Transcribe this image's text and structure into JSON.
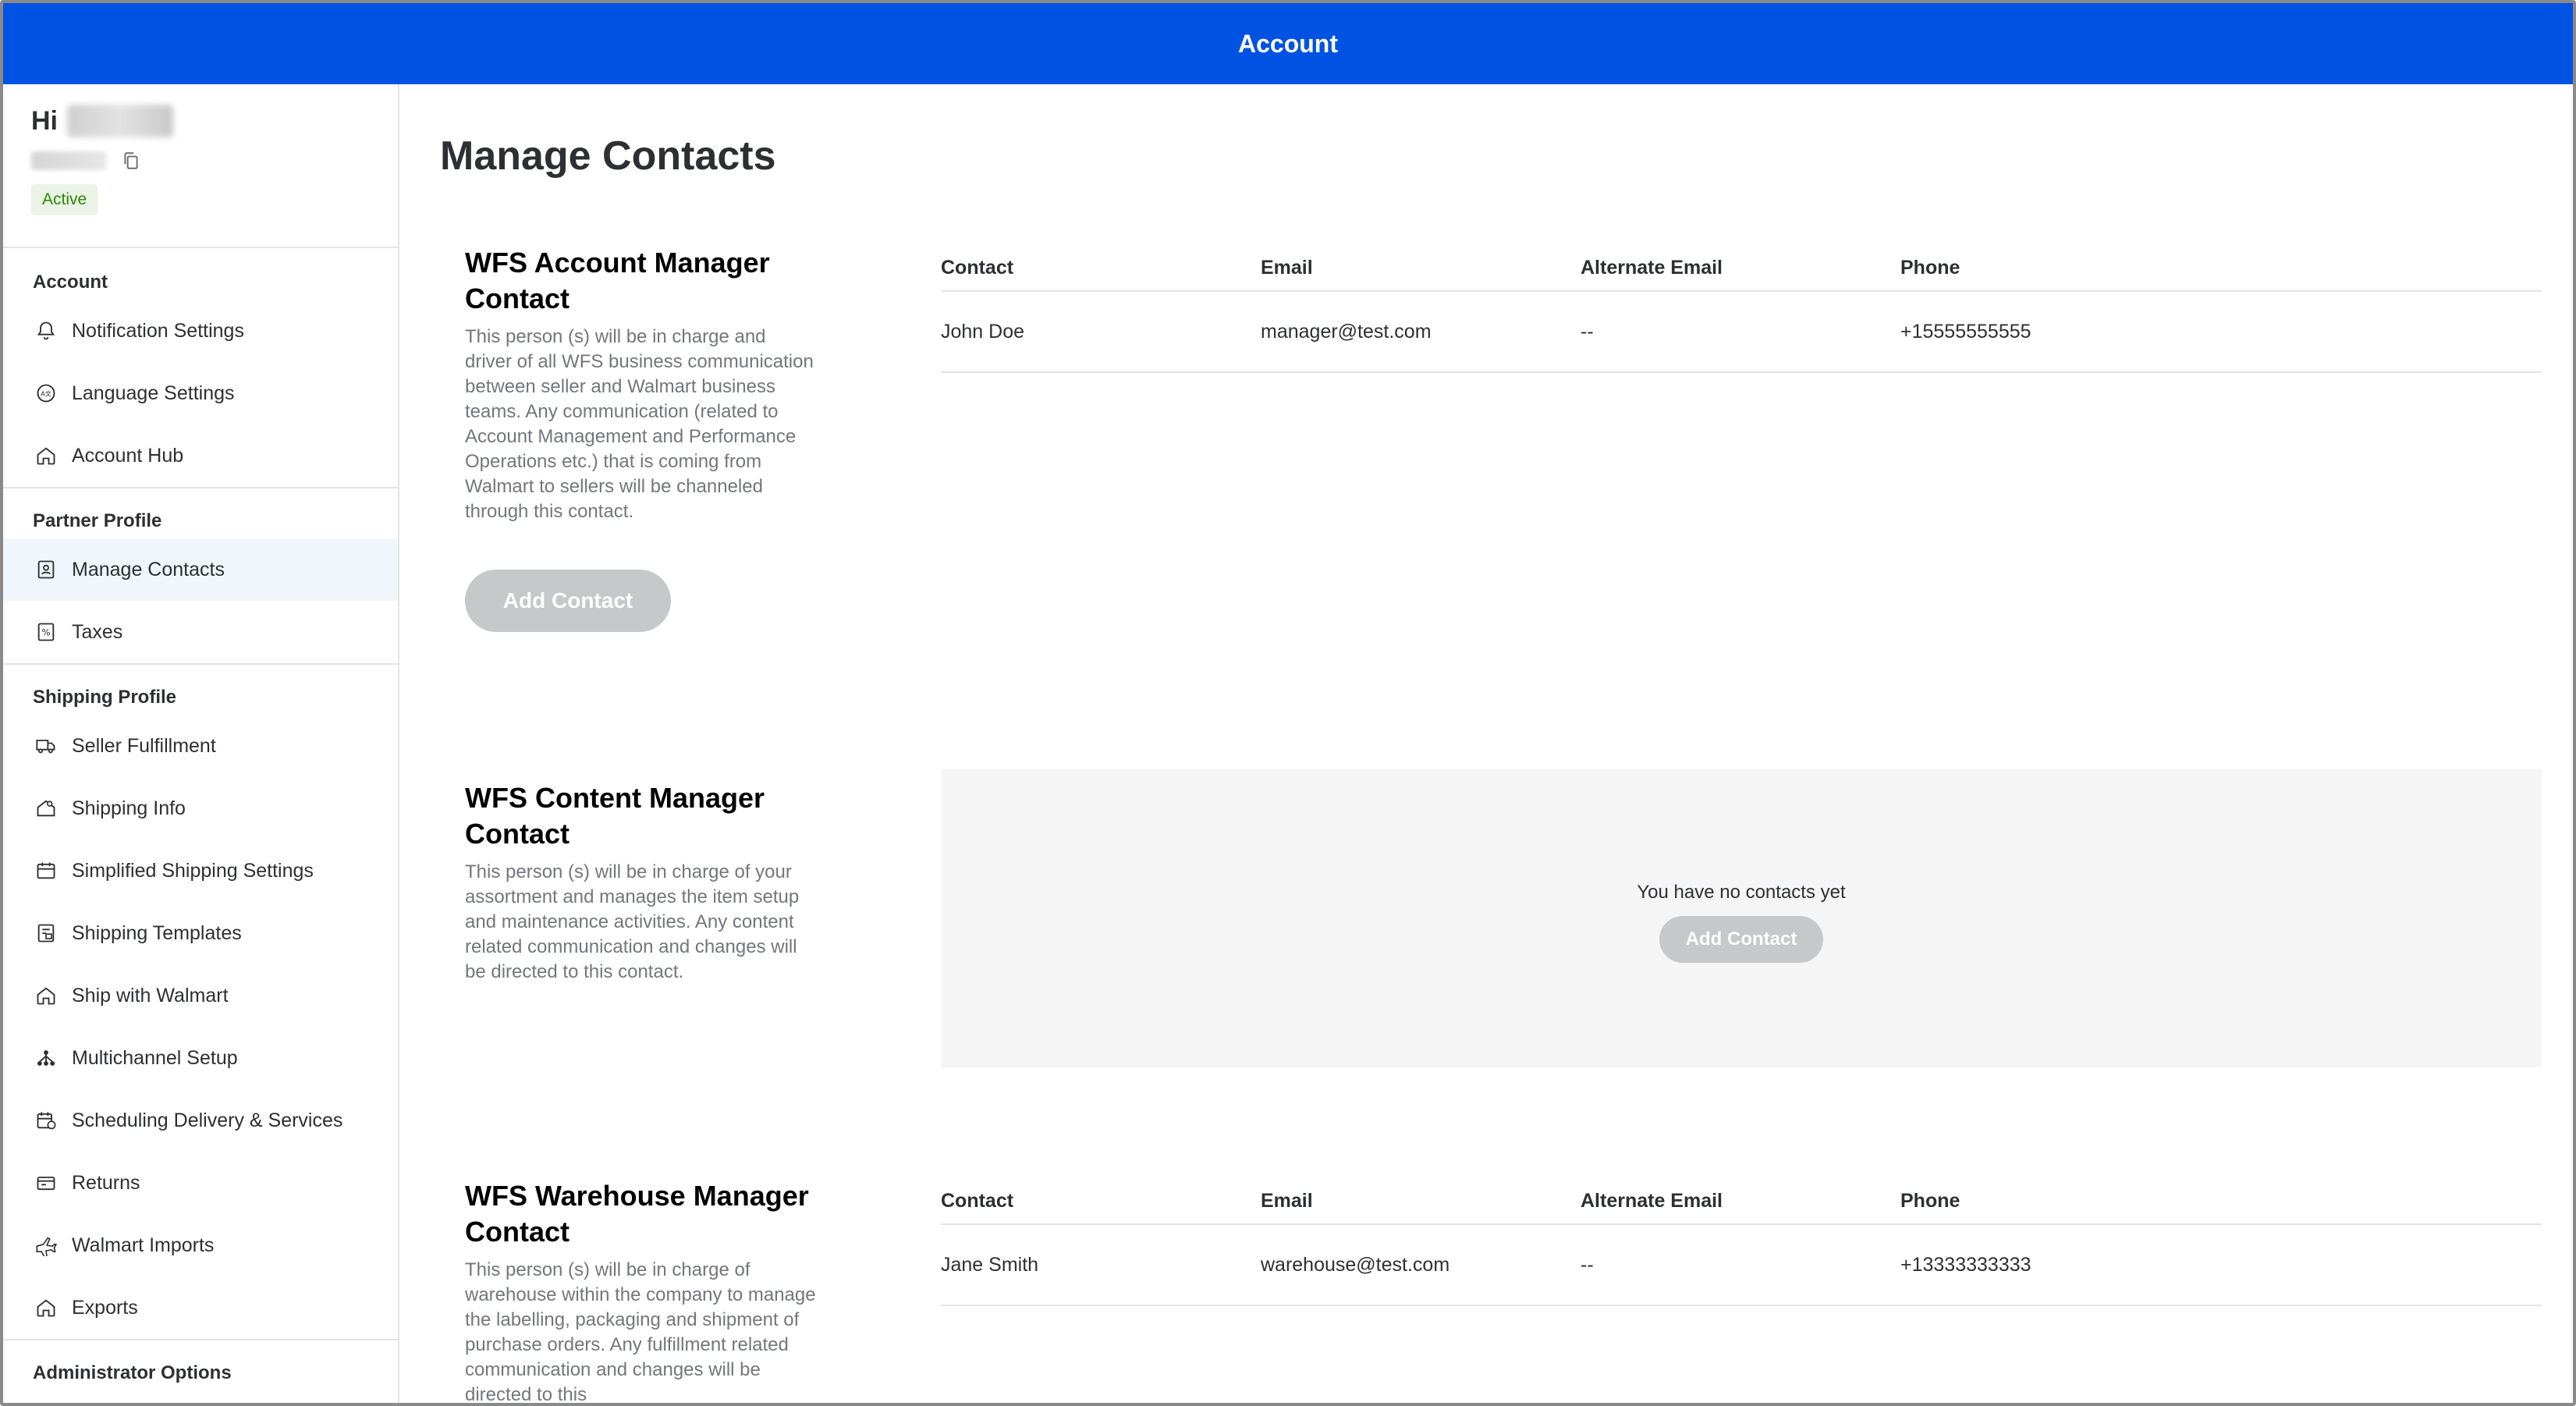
{
  "header": {
    "title": "Account"
  },
  "user": {
    "greeting": "Hi",
    "status_badge": "Active"
  },
  "sidebar": {
    "groups": [
      {
        "title": "Account",
        "items": [
          {
            "label": "Notification Settings",
            "icon": "bell-icon"
          },
          {
            "label": "Language Settings",
            "icon": "language-icon"
          },
          {
            "label": "Account Hub",
            "icon": "home-icon"
          }
        ]
      },
      {
        "title": "Partner Profile",
        "items": [
          {
            "label": "Manage Contacts",
            "icon": "contacts-icon",
            "active": true
          },
          {
            "label": "Taxes",
            "icon": "tax-icon"
          }
        ]
      },
      {
        "title": "Shipping Profile",
        "items": [
          {
            "label": "Seller Fulfillment",
            "icon": "truck-icon"
          },
          {
            "label": "Shipping Info",
            "icon": "house-settings-icon"
          },
          {
            "label": "Simplified Shipping Settings",
            "icon": "calendar-icon"
          },
          {
            "label": "Shipping Templates",
            "icon": "template-icon"
          },
          {
            "label": "Ship with Walmart",
            "icon": "home-icon"
          },
          {
            "label": "Multichannel Setup",
            "icon": "network-icon"
          },
          {
            "label": "Scheduling Delivery & Services",
            "icon": "schedule-icon"
          },
          {
            "label": "Returns",
            "icon": "returns-icon"
          },
          {
            "label": "Walmart Imports",
            "icon": "plane-icon"
          },
          {
            "label": "Exports",
            "icon": "home-icon"
          }
        ]
      },
      {
        "title": "Administrator Options",
        "items": []
      }
    ]
  },
  "main": {
    "title": "Manage Contacts",
    "sections": [
      {
        "title": "WFS Account Manager Contact",
        "description": "This person (s) will be in charge and driver of all WFS business communication between seller and Walmart business teams. Any communication (related to Account Management and Performance Operations etc.) that is coming from Walmart to sellers will be channeled through this contact.",
        "add_button": "Add Contact",
        "columns": [
          "Contact",
          "Email",
          "Alternate Email",
          "Phone"
        ],
        "rows": [
          {
            "contact": "John Doe",
            "email": "manager@test.com",
            "alt_email": "--",
            "phone": "+15555555555"
          }
        ]
      },
      {
        "title": "WFS Content Manager Contact",
        "description": "This person (s) will be in charge of your assortment and manages the item setup and maintenance activities. Any content related communication and changes will be directed to this contact.",
        "empty_text": "You have no contacts yet",
        "add_button": "Add Contact"
      },
      {
        "title": "WFS Warehouse Manager Contact",
        "description": "This person (s) will be in charge of warehouse within the company to manage the labelling, packaging and shipment of purchase orders. Any fulfillment related communication and changes will be directed to this",
        "columns": [
          "Contact",
          "Email",
          "Alternate Email",
          "Phone"
        ],
        "rows": [
          {
            "contact": "Jane Smith",
            "email": "warehouse@test.com",
            "alt_email": "--",
            "phone": "+13333333333"
          }
        ]
      }
    ]
  },
  "colors": {
    "brand_blue": "#0053e2",
    "active_badge_bg": "#eaf3e6",
    "active_badge_text": "#2a8703",
    "disabled_button": "#c7c8ca"
  }
}
